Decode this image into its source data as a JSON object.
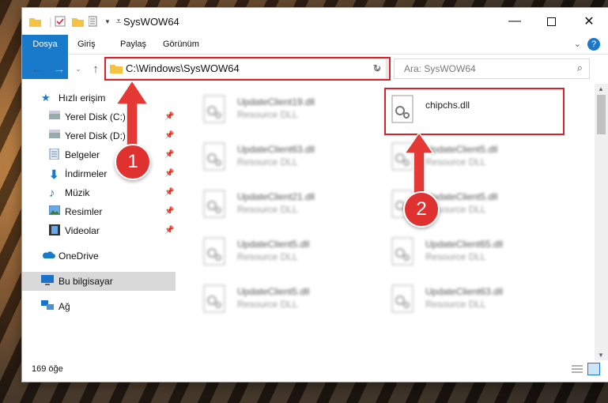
{
  "window": {
    "title": "SysWOW64"
  },
  "ribbon": {
    "tabs": [
      "Dosya",
      "Giriş",
      "Paylaş",
      "Görünüm"
    ]
  },
  "address": {
    "path": "C:\\Windows\\SysWOW64"
  },
  "search": {
    "placeholder": "Ara: SysWOW64"
  },
  "sidebar": {
    "items": [
      {
        "label": "Hızlı erişim",
        "icon": "star-icon"
      },
      {
        "label": "Yerel Disk (C:)",
        "icon": "drive-icon",
        "pinned": true
      },
      {
        "label": "Yerel Disk (D:)",
        "icon": "drive-icon",
        "pinned": true
      },
      {
        "label": "Belgeler",
        "icon": "documents-icon",
        "pinned": true
      },
      {
        "label": "İndirmeler",
        "icon": "download-icon",
        "pinned": true
      },
      {
        "label": "Müzik",
        "icon": "music-icon",
        "pinned": true
      },
      {
        "label": "Resimler",
        "icon": "pictures-icon",
        "pinned": true
      },
      {
        "label": "Videolar",
        "icon": "videos-icon",
        "pinned": true
      },
      {
        "label": "OneDrive",
        "icon": "cloud-icon"
      },
      {
        "label": "Bu bilgisayar",
        "icon": "computer-icon",
        "selected": true
      },
      {
        "label": "Ağ",
        "icon": "network-icon"
      }
    ]
  },
  "files": [
    {
      "name": "UpdateClient19.dll",
      "type": "Resource DLL"
    },
    {
      "name": "chipchs.dll",
      "type": ""
    },
    {
      "name": "UpdateClient63.dll",
      "type": "Resource DLL"
    },
    {
      "name": "UpdateClient5.dll",
      "type": "Resource DLL"
    },
    {
      "name": "UpdateClient21.dll",
      "type": "Resource DLL"
    },
    {
      "name": "UpdateClient5.dll",
      "type": "Resource DLL"
    },
    {
      "name": "UpdateClient5.dll",
      "type": "Resource DLL"
    },
    {
      "name": "UpdateClient65.dll",
      "type": "Resource DLL"
    },
    {
      "name": "UpdateClient5.dll",
      "type": "Resource DLL"
    },
    {
      "name": "UpdateClient63.dll",
      "type": "Resource DLL"
    }
  ],
  "status": {
    "count": "169 öğe"
  },
  "annotations": {
    "badge1": "1",
    "badge2": "2",
    "accent": "#d8232a"
  }
}
